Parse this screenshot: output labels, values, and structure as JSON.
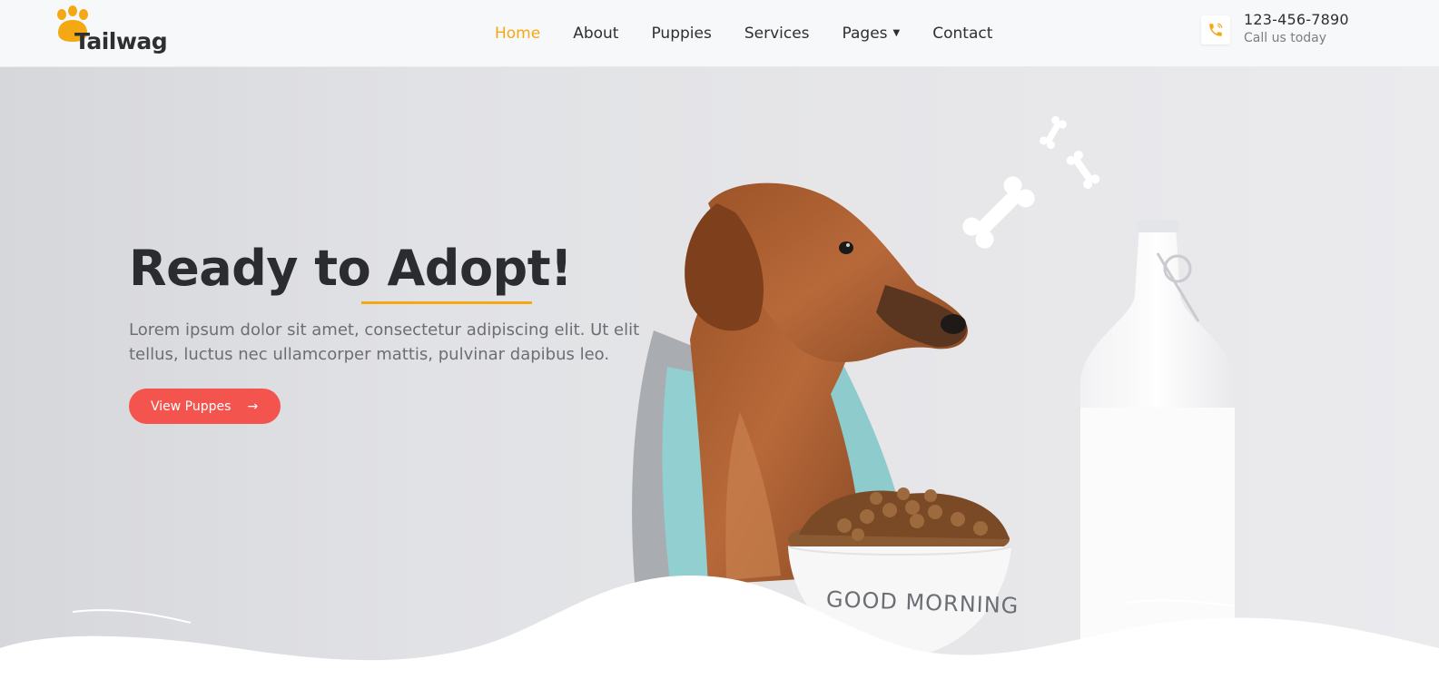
{
  "brand": {
    "name": "Tailwag",
    "logo_icon": "paw-icon",
    "accent": "#f3a814"
  },
  "nav": {
    "items": [
      {
        "label": "Home",
        "active": true
      },
      {
        "label": "About"
      },
      {
        "label": "Puppies"
      },
      {
        "label": "Services"
      },
      {
        "label": "Pages",
        "has_dropdown": true
      },
      {
        "label": "Contact"
      }
    ]
  },
  "contact": {
    "icon": "phone-icon",
    "number": "123-456-7890",
    "subtitle": "Call us today"
  },
  "hero": {
    "title": "Ready to Adopt!",
    "description": "Lorem ipsum dolor sit amet, consectetur adipiscing elit. Ut elit tellus, luctus nec ullamcorper mattis, pulvinar dapibus leo.",
    "cta_label": "View Puppes",
    "cta_icon": "arrow-right-icon",
    "cta_color": "#f4544e",
    "bowl_text": "GOOD MORNING"
  }
}
